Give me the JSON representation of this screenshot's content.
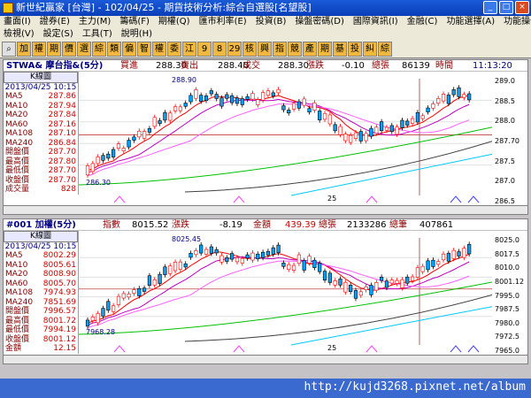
{
  "window": {
    "title": "新世紀贏家 [台灣] - 102/04/25 - 期貨技術分析:綜合自選股[名望股]"
  },
  "menu": {
    "row1": [
      "畫面(I)",
      "證券(E)",
      "主力(M)",
      "籌碼(F)",
      "期權(Q)",
      "匯市利率(E)",
      "投資(B)",
      "操盤密碼(D)",
      "國際資訊(I)",
      "金融(C)",
      "功能選擇(A)",
      "功能操作(F)"
    ],
    "row2": [
      "檢視(V)",
      "設定(S)",
      "工具(T)",
      "說明(H)"
    ]
  },
  "toolbar": [
    "加",
    "權",
    "期",
    "價",
    "選",
    "綜",
    "類",
    "偏",
    "智",
    "權",
    "委",
    "江",
    "9",
    "8",
    "29",
    "核",
    "興",
    "指",
    "競",
    "產",
    "期",
    "基",
    "投",
    "糾",
    "綜"
  ],
  "panel1": {
    "symbol": "STWA& 摩台指&(5分)",
    "buy_label": "買進",
    "buy": "288.30",
    "sell_label": "賣出",
    "sell": "288.40",
    "trade_label": "成交",
    "trade": "288.30",
    "chg_label": "漲跌",
    "chg": "-0.10",
    "vol_label": "總張",
    "vol": "86139",
    "time_label": "時間",
    "time": "11:13:20",
    "info_title": "K線圖",
    "date": "2013/04/25 10:15",
    "rows": [
      [
        "MA5",
        "287.86"
      ],
      [
        "MA10",
        "287.94"
      ],
      [
        "MA20",
        "287.84"
      ],
      [
        "MA60",
        "287.16"
      ],
      [
        "MA108",
        "287.10"
      ],
      [
        "MA240",
        "286.84"
      ],
      [
        "開盤價",
        "287.70"
      ],
      [
        "最高價",
        "287.80"
      ],
      [
        "最低價",
        "287.70"
      ],
      [
        "收盤價",
        "287.70"
      ],
      [
        "成交量",
        "828"
      ]
    ],
    "hi_label": "288.90",
    "lo_label": "286.30",
    "xlabel": "25",
    "scale": [
      "289.0",
      "288.5",
      "288.0",
      "287.70",
      "287.5",
      "287.0",
      "286.5"
    ]
  },
  "panel2": {
    "symbol": "#001 加權(5分)",
    "idx_label": "指數",
    "idx": "8015.52",
    "chg_label": "漲跌",
    "chg": "-8.19",
    "amt_label": "金額",
    "amt": "439.39",
    "tot_label": "總張",
    "tot": "2133286",
    "cnt_label": "總筆",
    "cnt": "407861",
    "info_title": "K線圖",
    "date": "2013/04/25 10:15",
    "rows": [
      [
        "MA5",
        "8002.29"
      ],
      [
        "MA10",
        "8005.61"
      ],
      [
        "MA20",
        "8008.90"
      ],
      [
        "MA60",
        "8005.70"
      ],
      [
        "MA108",
        "7974.93"
      ],
      [
        "MA240",
        "7851.69"
      ],
      [
        "開盤價",
        "7996.57"
      ],
      [
        "最高價",
        "8001.72"
      ],
      [
        "最低價",
        "7994.19"
      ],
      [
        "收盤價",
        "8001.12"
      ],
      [
        "金額",
        "12.15"
      ]
    ],
    "hi_label": "8025.45",
    "lo_label": "7968.28",
    "xlabel": "25",
    "scale": [
      "8025.0",
      "8017.5",
      "8010.0",
      "8001.12",
      "7995.0",
      "7987.5",
      "7980.0",
      "7972.5",
      "7965.0"
    ]
  },
  "watermark": "http://kujd3268.pixnet.net/album"
}
